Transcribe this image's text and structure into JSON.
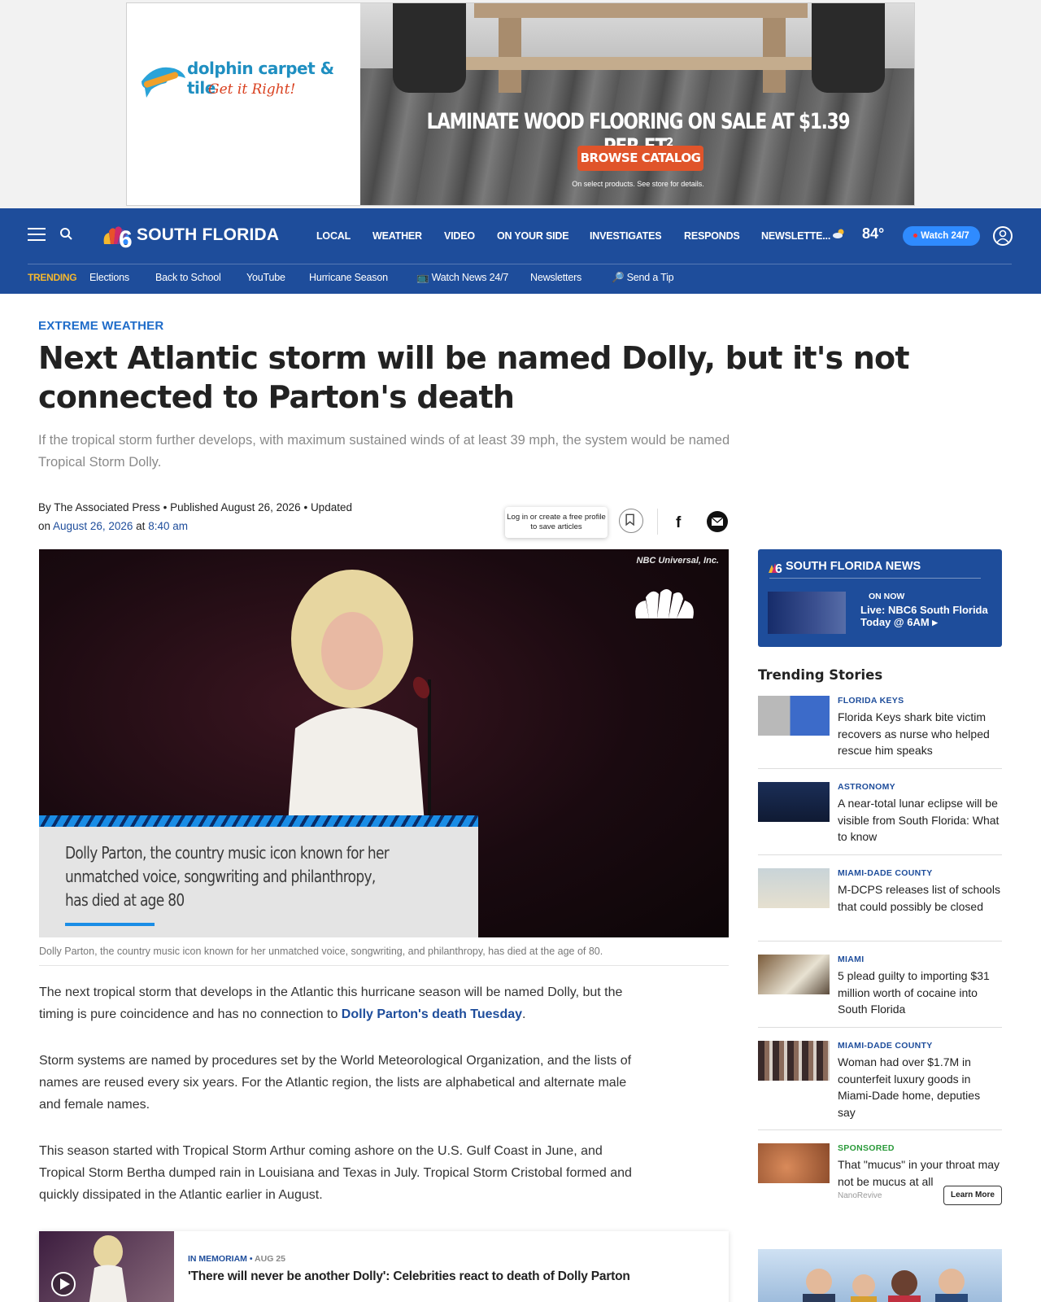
{
  "ad": {
    "brand": "dolphin carpet & tile",
    "tagline": "Get it Right!",
    "headline": "LAMINATE WOOD FLOORING ON SALE AT $1.39 PER FT²",
    "cta": "BROWSE CATALOG",
    "fine_print": "On select products. See store for details."
  },
  "header": {
    "logo_text": "SOUTH FLORIDA",
    "nav": [
      "LOCAL",
      "WEATHER",
      "VIDEO",
      "ON YOUR SIDE",
      "INVESTIGATES",
      "RESPONDS",
      "NEWSLETTE..."
    ],
    "temperature": "84°",
    "watch_label": "Watch 24/7",
    "trending_label": "TRENDING",
    "trending": [
      "Elections",
      "Back to School",
      "YouTube",
      "Hurricane Season",
      "Watch News 24/7",
      "Newsletters",
      "Send a Tip"
    ],
    "icons": [
      "menu-icon",
      "search-icon",
      "peacock-icon",
      "partly-cloudy-icon",
      "user-icon"
    ]
  },
  "article": {
    "kicker": "EXTREME WEATHER",
    "headline": "Next Atlantic storm will be named Dolly, but it's not connected to Parton's death",
    "dek": "If the tropical storm further develops, with maximum sustained winds of at least 39 mph, the system would be named Tropical Storm Dolly.",
    "byline_by": "By The Associated Press",
    "byline_published": "Published August 26, 2026",
    "byline_updated": "Updated",
    "byline_on": "on",
    "updated_date": "August 26, 2026",
    "byline_at": "at",
    "updated_time": "8:40 am",
    "save_tip": "Log in or create a free profile to save articles",
    "image_credit": "NBC Universal, Inc.",
    "image_overlay": "Dolly Parton, the country music icon known for her unmatched voice, songwriting and philanthropy, has died at age 80",
    "photo_caption": "Dolly Parton, the country music icon known for her unmatched voice, songwriting, and philanthropy, has died at the age of 80.",
    "p1_text": "The next tropical storm that develops in the Atlantic this hurricane season will be named Dolly, but the timing is pure coincidence and has no connection to",
    "p1_link": "Dolly Parton's death Tuesday",
    "p2": "Storm systems are named by procedures set by the World Meteorological Organization, and the lists of names are reused every six years. For the Atlantic region, the lists are alphabetical and alternate male and female names.",
    "p3": "This season started with Tropical Storm Arthur coming ashore on the U.S. Gulf Coast in June, and Tropical Storm Bertha dumped rain in Louisiana and Texas in July. Tropical Storm Cristobal formed and quickly dissipated in the Atlantic earlier in August.",
    "related_kicker": "IN MEMORIAM",
    "related_date": "AUG 25",
    "related_title": "'There will never be another Dolly': Celebrities react to death of Dolly Parton"
  },
  "sidebar": {
    "news_title": "SOUTH FLORIDA NEWS",
    "on_now": "ON NOW",
    "live_title": "Live: NBC6 South Florida Today @ 6AM",
    "trending_title": "Trending Stories",
    "stories": [
      {
        "kicker": "FLORIDA KEYS",
        "title": "Florida Keys shark bite victim recovers as nurse who helped rescue him speaks"
      },
      {
        "kicker": "ASTRONOMY",
        "title": "A near-total lunar eclipse will be visible from South Florida: What to know"
      },
      {
        "kicker": "MIAMI-DADE COUNTY",
        "title": "M-DCPS releases list of schools that could possibly be closed"
      },
      {
        "kicker": "MIAMI",
        "title": "5 plead guilty to importing $31 million worth of cocaine into South Florida"
      },
      {
        "kicker": "MIAMI-DADE COUNTY",
        "title": "Woman had over $1.7M in counterfeit luxury goods in Miami-Dade home, deputies say"
      }
    ],
    "sponsored": {
      "kicker": "SPONSORED",
      "title": "That \"mucus\" in your throat may not be mucus at all",
      "source": "NanoRevive",
      "cta": "Learn More"
    }
  },
  "colors": {
    "brand_blue": "#1e4d9b",
    "trending_yellow": "#f5b82e",
    "link_blue": "#1f6cc9",
    "watch_button": "#2f8bff"
  }
}
